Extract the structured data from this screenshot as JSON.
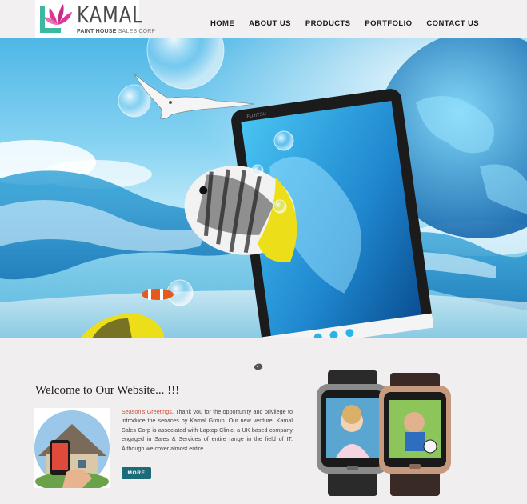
{
  "brand": {
    "name": "KAMAL",
    "tagline_main": "PAINT HOUSE",
    "tagline_sub": "SALES CORP"
  },
  "nav": {
    "items": [
      "HOME",
      "ABOUT US",
      "PRODUCTS",
      "PORTFOLIO",
      "CONTACT US"
    ]
  },
  "hero": {
    "screen_brand": "FUJITSU"
  },
  "welcome": {
    "title": "Welcome to Our Website... !!!",
    "greeting": "Season's Greetings",
    "body": ". Thank you for the opportunity and privilege to introduce the services by Kamal Group. Our new venture, Kamal Sales Corp is associated with Laptop Clinic, a UK based company engaged in Sales & Services of entire range in the field of IT. Although we cover almost entire...",
    "more_label": "MORE"
  },
  "colors": {
    "accent": "#1c6b78",
    "highlight": "#d24a3a",
    "logo_pink": "#e0359a",
    "logo_green": "#3db8a0"
  }
}
